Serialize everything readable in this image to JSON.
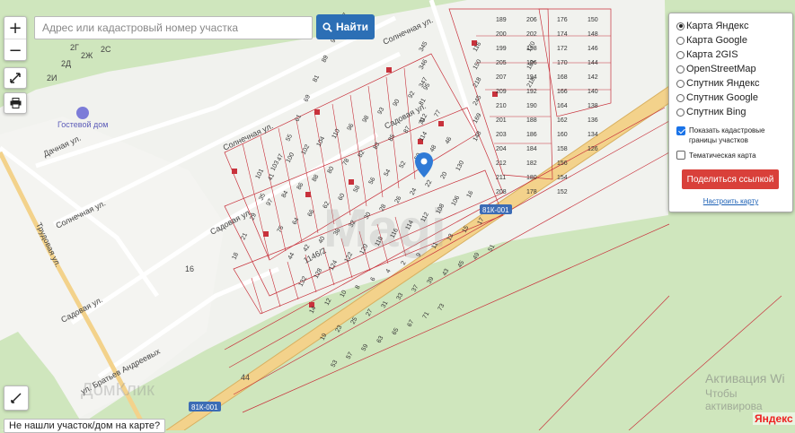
{
  "search": {
    "placeholder": "Адрес или кадастровый номер участка",
    "button_label": "Найти"
  },
  "zoom": {
    "in_label": "+",
    "out_label": "−"
  },
  "layers": {
    "options": [
      "Карта Яндекс",
      "Карта Google",
      "Карта 2GIS",
      "OpenStreetMap",
      "Спутник Яндекс",
      "Спутник Google",
      "Спутник Bing"
    ],
    "selected": "Карта Яндекс",
    "show_cadastral_label": "Показать кадастровые границы участков",
    "show_cadastral_checked": true,
    "thematic_label": "Тематическая карта",
    "thematic_checked": false,
    "share_label": "Поделиться ссылкой",
    "configure_label": "Настроить карту"
  },
  "bottom": {
    "not_found_label": "Не нашли участок/дом на карте?"
  },
  "watermark": {
    "activation_title": "Активация Wi",
    "activation_sub": "Чтобы активирова",
    "domclick": "ДомКлик",
    "brand": "Яндекс"
  },
  "map": {
    "poi": "Гостевой дом",
    "streets": {
      "solnechnaya_1": "Солнечная ул.",
      "solnechnaya_2": "Солнечная ул.",
      "solnechnaya_3": "Солнечная ул.",
      "dachnaya": "Дачная ул.",
      "trudovaya": "Трудовая ул.",
      "sadovaya_1": "Садовая ул.",
      "sadovaya_2": "Садовая ул.",
      "sadovaya_3": "Садовая ул.",
      "bratyev": "ул. Братьев Андреевых"
    },
    "road_badges": [
      "81К-001",
      "81К-001"
    ],
    "road_number": "44",
    "address_1460": "1146/2",
    "house_16": "16",
    "house_2g": "2Г",
    "house_2d": "2Д",
    "house_2zh": "2Ж",
    "house_2s": "2С",
    "house_2i": "2И",
    "left_plots": [
      "18",
      "21",
      "29",
      "35",
      "41",
      "47",
      "55",
      "61",
      "69",
      "81",
      "89",
      "99",
      "107"
    ],
    "plot_labels": [
      "101",
      "103",
      "100",
      "102",
      "104",
      "110",
      "96",
      "98",
      "93",
      "90",
      "92",
      "95",
      "97",
      "84",
      "86",
      "88",
      "80",
      "78",
      "82",
      "83",
      "85",
      "87",
      "79",
      "77",
      "75",
      "64",
      "66",
      "62",
      "60",
      "58",
      "56",
      "54",
      "52",
      "50",
      "48",
      "46",
      "44",
      "42",
      "40",
      "36",
      "32",
      "30",
      "28",
      "26",
      "24",
      "22",
      "20",
      "130",
      "132",
      "128",
      "124",
      "122",
      "120",
      "118",
      "116",
      "114",
      "112",
      "108",
      "106",
      "16",
      "14",
      "12",
      "10",
      "8",
      "6",
      "4",
      "2",
      "9",
      "11",
      "13",
      "15",
      "17",
      "19",
      "23",
      "25",
      "27",
      "31",
      "33",
      "37",
      "39",
      "43",
      "45",
      "49",
      "51",
      "53",
      "57",
      "59",
      "63",
      "65",
      "67",
      "71",
      "73"
    ],
    "right_plots": [
      "189",
      "200",
      "199",
      "205",
      "207",
      "209",
      "210",
      "201",
      "203",
      "204",
      "212",
      "211",
      "208",
      "206",
      "202",
      "198",
      "196",
      "194",
      "192",
      "190",
      "188",
      "186",
      "184",
      "182",
      "180",
      "178",
      "176",
      "174",
      "172",
      "170",
      "168",
      "166",
      "164",
      "162",
      "160",
      "158",
      "156",
      "154",
      "152",
      "150",
      "148",
      "146",
      "144",
      "142",
      "140",
      "138",
      "136",
      "134",
      "126"
    ],
    "misc_plots": [
      "345",
      "346",
      "347",
      "81",
      "112",
      "114",
      "116",
      "150",
      "218",
      "245",
      "169",
      "148",
      "170",
      "181",
      "218"
    ]
  },
  "colors": {
    "map_bg": "#cfe6bd",
    "road": "#f3d28b",
    "parcel": "#c8323c",
    "accent": "#2c6fb5",
    "share": "#d9403a"
  }
}
